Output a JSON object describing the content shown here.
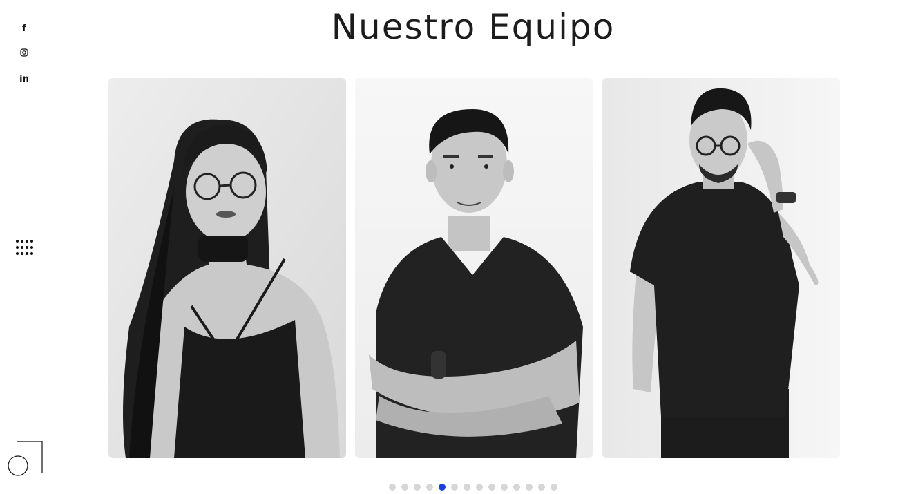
{
  "page": {
    "title": "Nuestro Equipo"
  },
  "sidebar": {
    "social": [
      {
        "icon": "facebook-icon",
        "glyph": "f"
      },
      {
        "icon": "instagram-icon"
      },
      {
        "icon": "linkedin-icon",
        "glyph": "in"
      }
    ],
    "menu_icon": "grid-menu-icon",
    "logo": "brand-logo"
  },
  "team": [
    {
      "photo": "team-photo-1"
    },
    {
      "photo": "team-photo-2"
    },
    {
      "photo": "team-photo-3"
    }
  ],
  "carousel": {
    "total_slides": 14,
    "active_index": 4
  },
  "colors": {
    "accent": "#1f3fd6",
    "dot_inactive": "#d6d6d6",
    "text": "#1c1c1c"
  }
}
